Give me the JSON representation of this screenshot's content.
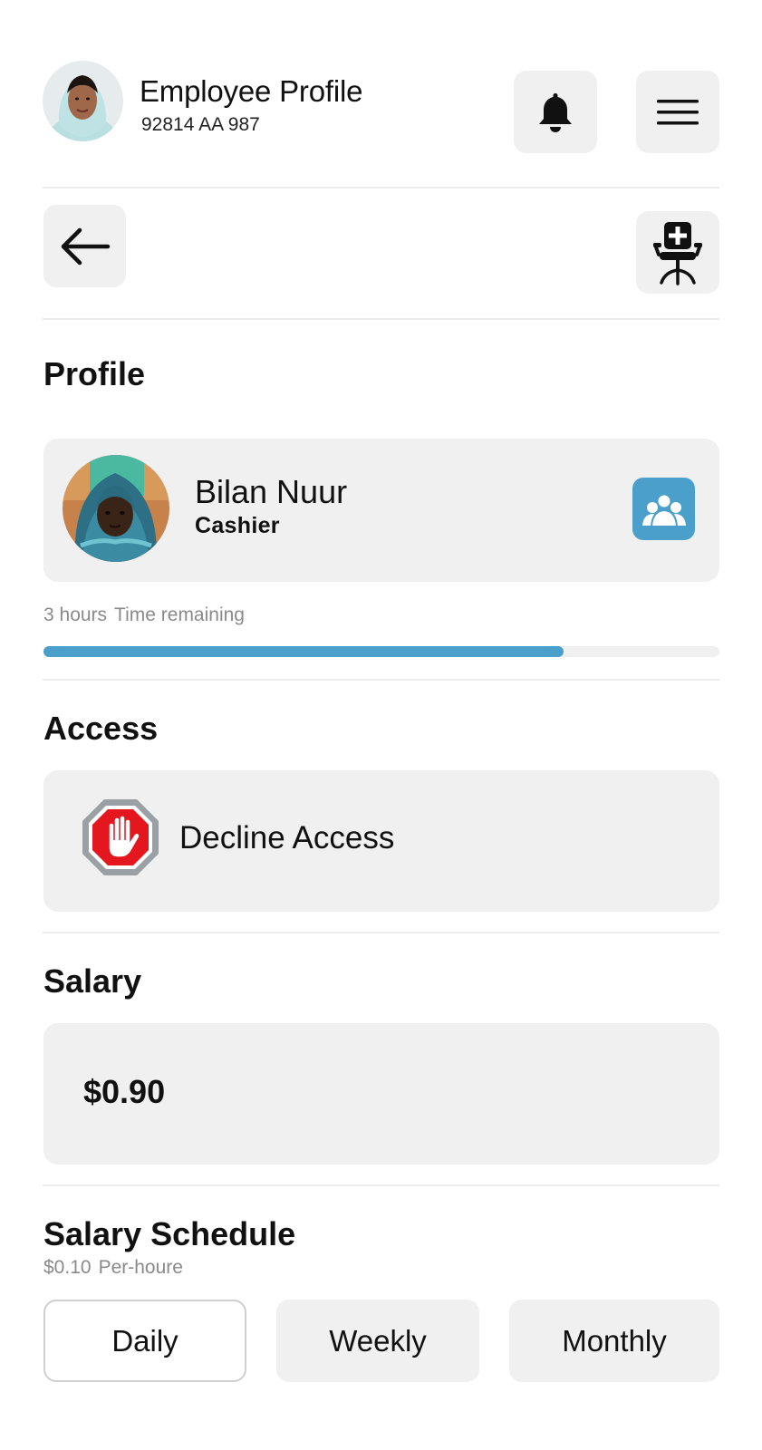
{
  "header": {
    "title": "Employee Profile",
    "subtitle": "92814 AA 987",
    "notification_icon": "bell-icon",
    "menu_icon": "hamburger-menu-icon"
  },
  "toolbar": {
    "back_icon": "arrow-left-icon",
    "chair_icon": "office-chair-plus-icon"
  },
  "profile": {
    "section_title": "Profile",
    "name": "Bilan Nuur",
    "role": "Cashier",
    "team_icon": "team-icon",
    "time_value": "3 hours",
    "time_label": "Time remaining",
    "progress_fraction": 0.77
  },
  "access": {
    "section_title": "Access",
    "decline_label": "Decline Access",
    "decline_icon": "stop-hand-icon"
  },
  "salary": {
    "section_title": "Salary",
    "value": "$0.90"
  },
  "schedule": {
    "section_title": "Salary Schedule",
    "rate_value": "$0.10",
    "rate_label": "Per-houre",
    "options": [
      {
        "label": "Daily",
        "selected": true
      },
      {
        "label": "Weekly",
        "selected": false
      },
      {
        "label": "Monthly",
        "selected": false
      }
    ]
  },
  "colors": {
    "accent": "#4a9fcb",
    "card_bg": "#f0f0f0",
    "muted_text": "#8a8a8a",
    "stop_red": "#e4161e",
    "stop_rim": "#9aa0a3"
  }
}
